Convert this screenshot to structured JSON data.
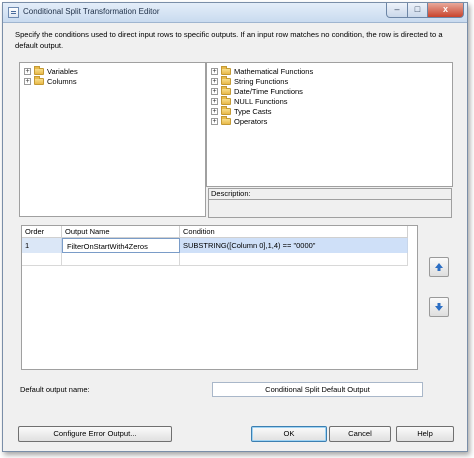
{
  "window": {
    "title": "Conditional Split Transformation Editor",
    "close_label": "x"
  },
  "intro_text": "Specify the conditions used to direct input rows to specific outputs. If an input row matches no condition, the row is directed to a default output.",
  "left_tree": [
    {
      "label": "Variables"
    },
    {
      "label": "Columns"
    }
  ],
  "right_tree": [
    {
      "label": "Mathematical Functions"
    },
    {
      "label": "String Functions"
    },
    {
      "label": "Date/Time Functions"
    },
    {
      "label": "NULL Functions"
    },
    {
      "label": "Type Casts"
    },
    {
      "label": "Operators"
    }
  ],
  "description_label": "Description:",
  "grid": {
    "headers": [
      "Order",
      "Output Name",
      "Condition"
    ],
    "rows": [
      {
        "order": "1",
        "output_name": "FilterOnStartWith4Zeros",
        "condition": "SUBSTRING([Column 0],1,4) == \"0000\""
      }
    ]
  },
  "default_output_label": "Default output name:",
  "default_output_value": "Conditional Split Default Output",
  "buttons": {
    "configure_error": "Configure Error Output...",
    "ok": "OK",
    "cancel": "Cancel",
    "help": "Help"
  },
  "icons": {
    "move_up": "up-arrow-icon",
    "move_down": "down-arrow-icon"
  }
}
